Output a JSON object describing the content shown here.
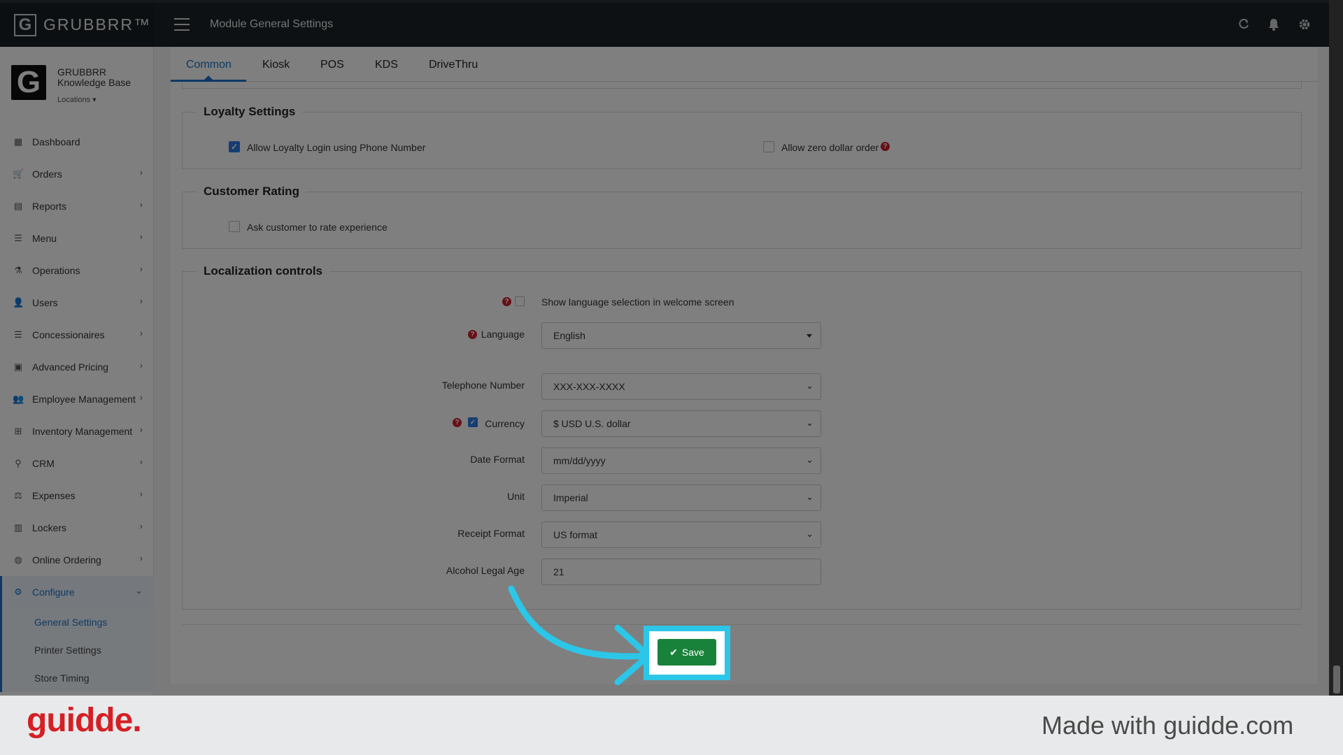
{
  "topbar": {
    "brand": "GRUBBRR™",
    "module_title": "Module General Settings"
  },
  "profile": {
    "logo_letter": "G",
    "name_line1": "GRUBBRR",
    "name_line2": "Knowledge Base",
    "locations_label": "Locations ▾"
  },
  "sidebar": {
    "items": [
      {
        "label": "Dashboard",
        "icon": "dashboard-icon"
      },
      {
        "label": "Orders",
        "icon": "cart-icon"
      },
      {
        "label": "Reports",
        "icon": "report-icon"
      },
      {
        "label": "Menu",
        "icon": "list-icon"
      },
      {
        "label": "Operations",
        "icon": "flask-icon"
      },
      {
        "label": "Users",
        "icon": "user-add-icon"
      },
      {
        "label": "Concessionaires",
        "icon": "list-icon"
      },
      {
        "label": "Advanced Pricing",
        "icon": "money-icon"
      },
      {
        "label": "Employee Management",
        "icon": "users-icon"
      },
      {
        "label": "Inventory Management",
        "icon": "sitemap-icon"
      },
      {
        "label": "CRM",
        "icon": "link-icon"
      },
      {
        "label": "Expenses",
        "icon": "balance-icon"
      },
      {
        "label": "Lockers",
        "icon": "lockers-icon"
      },
      {
        "label": "Online Ordering",
        "icon": "globe-icon"
      },
      {
        "label": "Configure",
        "icon": "gear-icon"
      }
    ],
    "configure_sub": [
      {
        "label": "General Settings"
      },
      {
        "label": "Printer Settings"
      },
      {
        "label": "Store Timing"
      }
    ]
  },
  "tabs": [
    "Common",
    "Kiosk",
    "POS",
    "KDS",
    "DriveThru"
  ],
  "loyalty": {
    "title": "Loyalty Settings",
    "phone_login_label": "Allow Loyalty Login using Phone Number",
    "phone_login_checked": true,
    "zero_dollar_label": "Allow zero dollar order",
    "zero_dollar_checked": false
  },
  "rating": {
    "title": "Customer Rating",
    "rate_label": "Ask customer to rate experience",
    "rate_checked": false
  },
  "localization": {
    "title": "Localization controls",
    "show_language_label": "Show language selection in welcome screen",
    "show_language_checked": false,
    "language_label": "Language",
    "language_value": "English",
    "telephone_label": "Telephone Number",
    "telephone_value": "XXX-XXX-XXXX",
    "currency_label": "Currency",
    "currency_checked": true,
    "currency_value": "$ USD U.S. dollar",
    "date_label": "Date Format",
    "date_value": "mm/dd/yyyy",
    "unit_label": "Unit",
    "unit_value": "Imperial",
    "receipt_label": "Receipt Format",
    "receipt_value": "US format",
    "alcohol_label": "Alcohol Legal Age",
    "alcohol_value": "21"
  },
  "save_label": "Save",
  "footer": {
    "logo": "guidde.",
    "made_with": "Made with guidde.com"
  },
  "colors": {
    "accent": "#1a73c8",
    "save_green": "#18823a",
    "highlight_cyan": "#2cc6e8",
    "help_red": "#cf1f2d",
    "guidde_red": "#d41f25"
  }
}
